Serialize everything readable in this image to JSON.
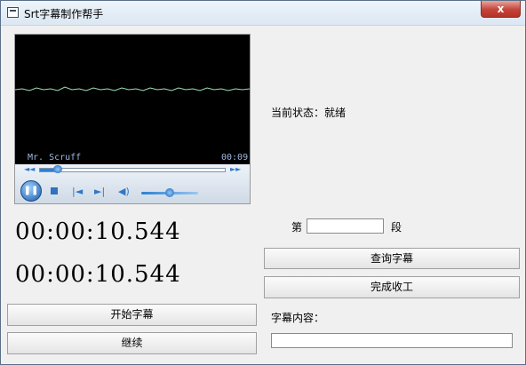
{
  "window": {
    "title": "Srt字幕制作帮手",
    "close_glyph": "x"
  },
  "player": {
    "artist": "Mr. Scruff",
    "time": "00:09",
    "rewind_glyph": "◄◄",
    "forward_glyph": "►►",
    "pause_glyph": "❚❚",
    "prev_glyph": "|◄",
    "next_glyph": "►|",
    "volume_glyph": "◀)",
    "progress_fraction": 0.1,
    "volume_fraction": 0.5
  },
  "times": {
    "start": "00:00:10.544",
    "end": "00:00:10.544"
  },
  "status": {
    "label": "当前状态：就绪"
  },
  "segment": {
    "prefix": "第",
    "suffix": "段",
    "value": ""
  },
  "buttons": {
    "query": "查询字幕",
    "finish": "完成收工",
    "start": "开始字幕",
    "continue": "继续"
  },
  "content": {
    "label": "字幕内容：",
    "value": ""
  }
}
